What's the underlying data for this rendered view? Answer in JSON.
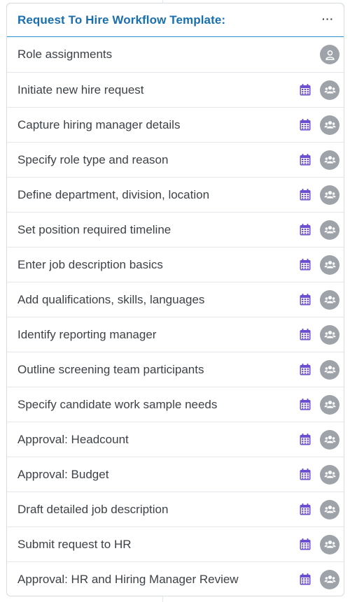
{
  "header": {
    "title": "Request To Hire Workflow Template:",
    "more_label": "···"
  },
  "rows": [
    {
      "label": "Role assignments",
      "calendar_icon": false,
      "avatar_icon": "single-user-icon"
    },
    {
      "label": "Initiate new hire request",
      "calendar_icon": true,
      "avatar_icon": "group-users-icon"
    },
    {
      "label": "Capture hiring manager details",
      "calendar_icon": true,
      "avatar_icon": "group-users-icon"
    },
    {
      "label": "Specify role type and reason",
      "calendar_icon": true,
      "avatar_icon": "group-users-icon"
    },
    {
      "label": "Define department, division, location",
      "calendar_icon": true,
      "avatar_icon": "group-users-icon"
    },
    {
      "label": "Set position required timeline",
      "calendar_icon": true,
      "avatar_icon": "group-users-icon"
    },
    {
      "label": "Enter job description basics",
      "calendar_icon": true,
      "avatar_icon": "group-users-icon"
    },
    {
      "label": "Add qualifications, skills, languages",
      "calendar_icon": true,
      "avatar_icon": "group-users-icon"
    },
    {
      "label": "Identify reporting manager",
      "calendar_icon": true,
      "avatar_icon": "group-users-icon"
    },
    {
      "label": "Outline screening team participants",
      "calendar_icon": true,
      "avatar_icon": "group-users-icon"
    },
    {
      "label": "Specify candidate work sample needs",
      "calendar_icon": true,
      "avatar_icon": "group-users-icon"
    },
    {
      "label": "Approval: Headcount",
      "calendar_icon": true,
      "avatar_icon": "group-users-icon"
    },
    {
      "label": "Approval: Budget",
      "calendar_icon": true,
      "avatar_icon": "group-users-icon"
    },
    {
      "label": "Draft detailed job description",
      "calendar_icon": true,
      "avatar_icon": "group-users-icon"
    },
    {
      "label": "Submit request to HR",
      "calendar_icon": true,
      "avatar_icon": "group-users-icon"
    },
    {
      "label": "Approval: HR and Hiring Manager Review",
      "calendar_icon": true,
      "avatar_icon": "group-users-icon"
    }
  ],
  "colors": {
    "header_text": "#1a6fae",
    "header_border": "#2b8fd0",
    "calendar_icon": "#6b4fd0",
    "avatar_bg": "#9ea3a9",
    "row_text": "#3d4247"
  }
}
